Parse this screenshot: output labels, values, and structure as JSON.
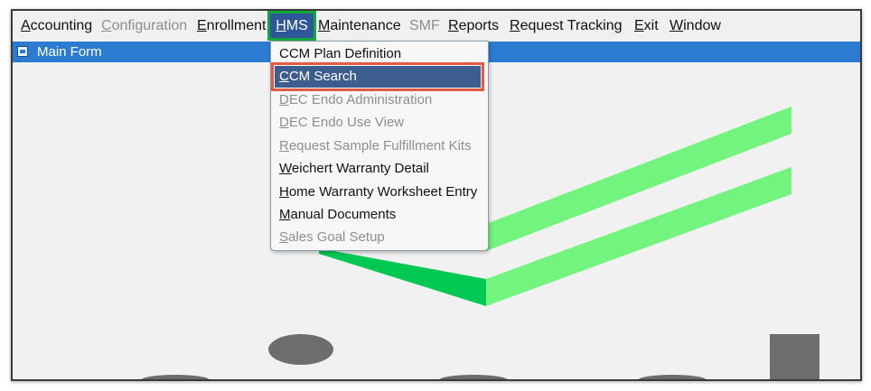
{
  "menubar": {
    "items": [
      {
        "accel": "A",
        "rest": "ccounting"
      },
      {
        "accel": "C",
        "rest": "onfiguration"
      },
      {
        "accel": "E",
        "rest": "nrollment"
      },
      {
        "accel": "H",
        "rest": "MS"
      },
      {
        "accel": "M",
        "rest": "aintenance"
      },
      {
        "accel": "",
        "rest": "SMF"
      },
      {
        "accel": "R",
        "rest": "eports"
      },
      {
        "accel": "R",
        "rest": "equest Tracking"
      },
      {
        "accel": "E",
        "rest": "xit"
      },
      {
        "accel": "W",
        "rest": "indow"
      }
    ]
  },
  "window": {
    "title": "Main Form"
  },
  "hms_menu": {
    "items": [
      {
        "accel": "",
        "rest": "CCM Plan Definition"
      },
      {
        "accel": "C",
        "rest": "CM Search"
      },
      {
        "accel": "D",
        "rest": "EC Endo Administration"
      },
      {
        "accel": "D",
        "rest": "EC Endo Use View"
      },
      {
        "accel": "R",
        "rest": "equest Sample Fulfillment Kits"
      },
      {
        "accel": "W",
        "rest": "eichert Warranty Detail"
      },
      {
        "accel": "H",
        "rest": "ome Warranty Worksheet Entry"
      },
      {
        "accel": "M",
        "rest": "anual Documents"
      },
      {
        "accel": "S",
        "rest": "ales Goal Setup"
      }
    ]
  },
  "colors": {
    "menu_active": "#2f5698",
    "active_highlight_box": "#14a83c",
    "selected_item_box": "#e05a43",
    "titlebar": "#2b7bd0",
    "logo_light_green": "#72f47e",
    "logo_dark_green": "#00c853",
    "logo_gray": "#6b6e6c"
  }
}
